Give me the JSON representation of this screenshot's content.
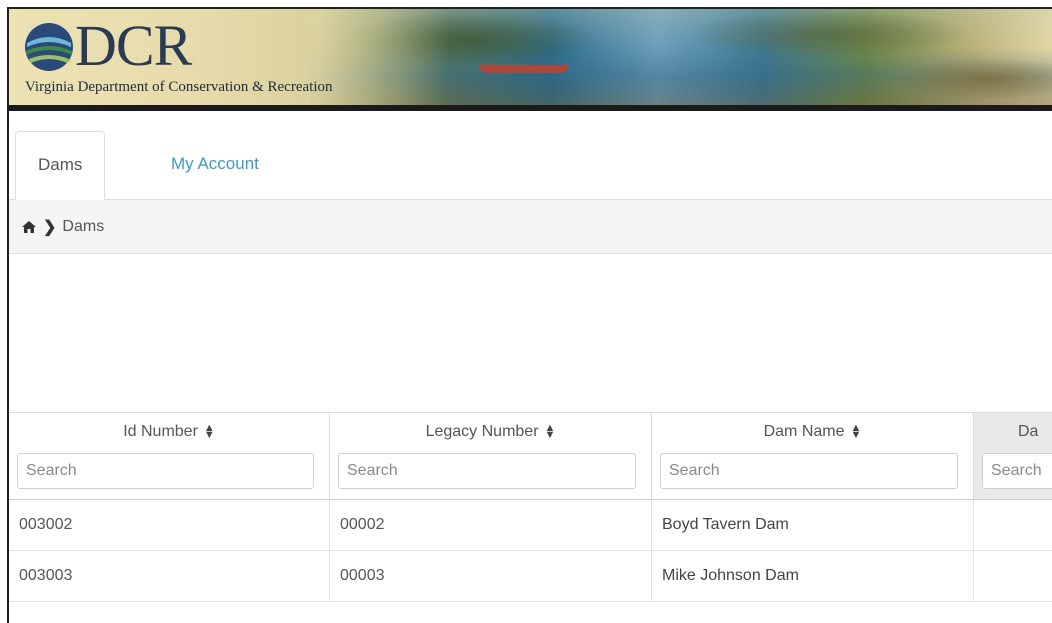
{
  "banner": {
    "logo_text": "DCR",
    "org_name": "Virginia Department of Conservation & Recreation"
  },
  "tabs": [
    {
      "label": "Dams",
      "active": true
    },
    {
      "label": "My Account",
      "active": false
    }
  ],
  "breadcrumb": {
    "home_icon": "home-icon",
    "separator_icon": "chevron-right-icon",
    "current": "Dams"
  },
  "table": {
    "columns": [
      {
        "label": "Id Number",
        "search_placeholder": "Search"
      },
      {
        "label": "Legacy Number",
        "search_placeholder": "Search"
      },
      {
        "label": "Dam Name",
        "search_placeholder": "Search"
      },
      {
        "label": "Da",
        "search_placeholder": "Search"
      }
    ],
    "rows": [
      {
        "id_number": "003002",
        "legacy_number": "00002",
        "dam_name": "Boyd Tavern Dam",
        "col4": ""
      },
      {
        "id_number": "003003",
        "legacy_number": "00003",
        "dam_name": "Mike Johnson Dam",
        "col4": ""
      }
    ]
  },
  "colors": {
    "link": "#3c9bc4",
    "breadcrumb_bg": "#f5f5f5",
    "header_gray": "#e9e9e9"
  }
}
